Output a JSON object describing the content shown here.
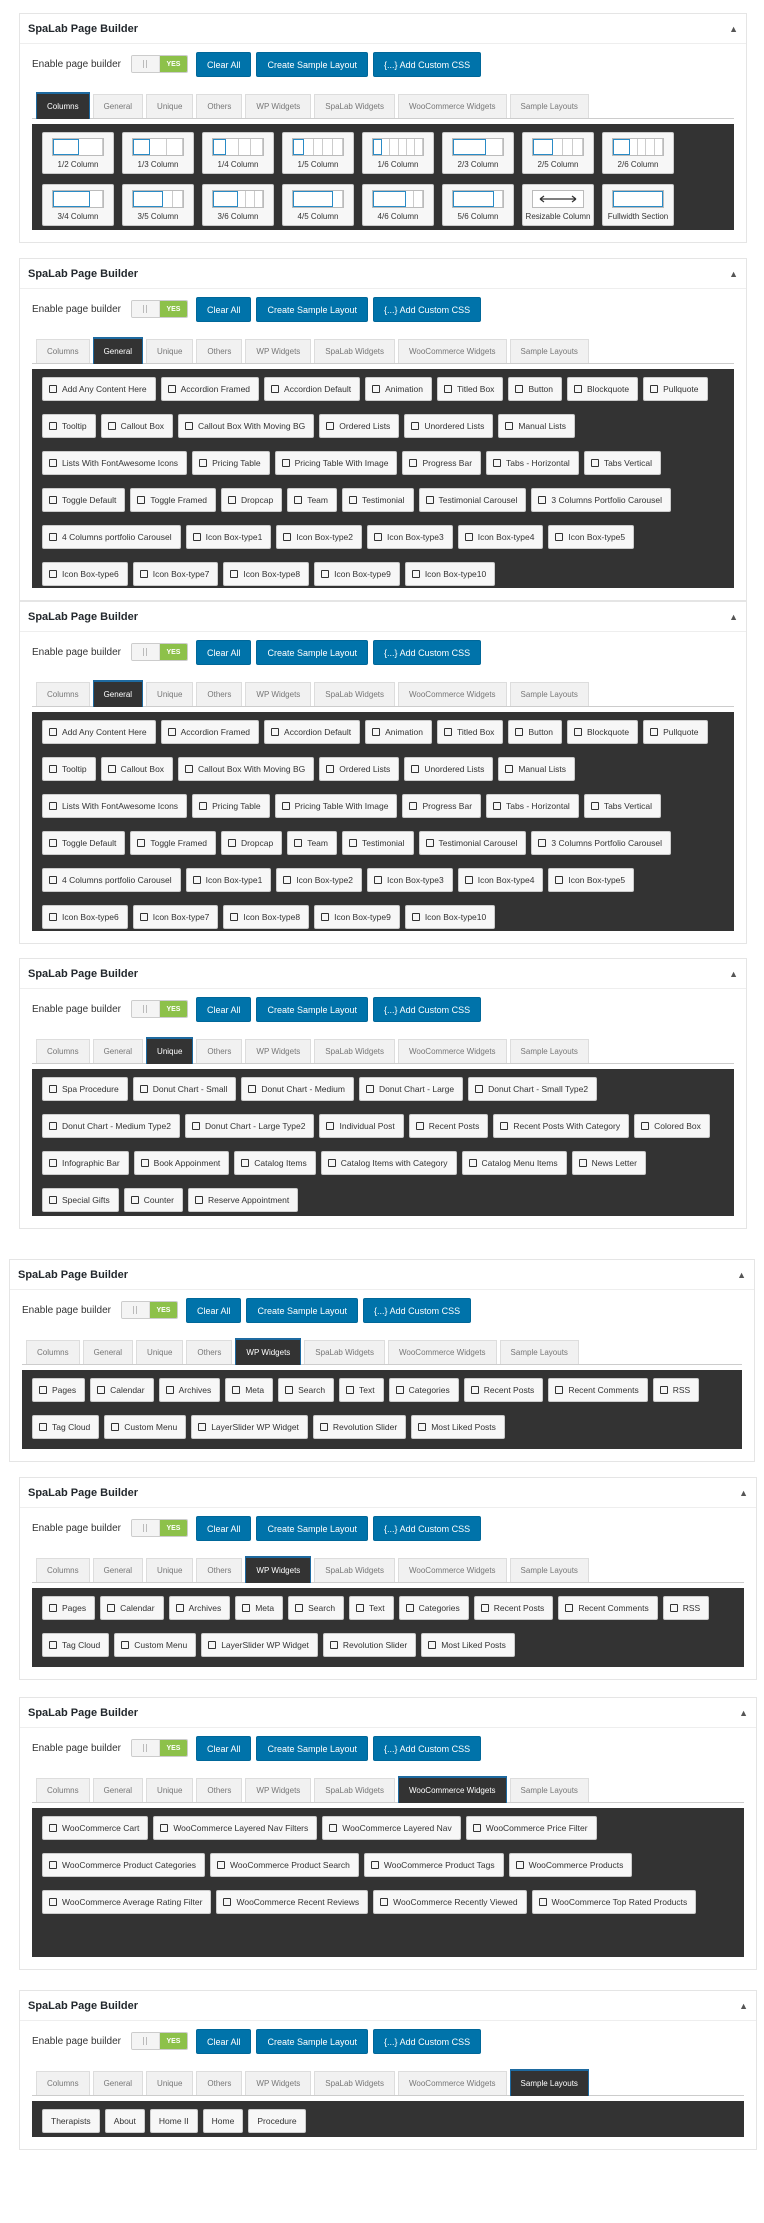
{
  "builder": {
    "title": "SpaLab Page Builder",
    "collapse_icon": "▲",
    "enable_label": "Enable page builder",
    "toggle_on": "YES",
    "buttons": {
      "clear": "Clear All",
      "sample": "Create Sample Layout",
      "css": "{...} Add Custom CSS"
    }
  },
  "tab_labels": [
    "Columns",
    "General",
    "Unique",
    "Others",
    "WP Widgets",
    "SpaLab Widgets",
    "WooCommerce Widgets",
    "Sample Layouts"
  ],
  "panels": [
    {
      "active_tab": 0,
      "columns": [
        "1/2 Column",
        "1/3 Column",
        "1/4 Column",
        "1/5 Column",
        "1/6 Column",
        "2/3 Column",
        "2/5 Column",
        "2/6 Column",
        "3/4 Column",
        "3/5 Column",
        "3/6 Column",
        "4/5 Column",
        "4/6 Column",
        "5/6 Column",
        "Resizable Column",
        "Fullwidth Section"
      ]
    },
    {
      "active_tab": 1,
      "items": [
        "Add Any Content Here",
        "Accordion Framed",
        "Accordion Default",
        "Animation",
        "Titled Box",
        "Button",
        "Blockquote",
        "Pullquote",
        "Tooltip",
        "Callout Box",
        "Callout Box With Moving BG",
        "Ordered Lists",
        "Unordered Lists",
        "Manual Lists",
        "Lists With FontAwesome Icons",
        "Pricing Table",
        "Pricing Table With Image",
        "Progress Bar",
        "Tabs - Horizontal",
        "Tabs Vertical",
        "Toggle Default",
        "Toggle Framed",
        "Dropcap",
        "Team",
        "Testimonial",
        "Testimonial Carousel",
        "3 Columns Portfolio Carousel",
        "4 Columns portfolio Carousel",
        "Icon Box-type1",
        "Icon Box-type2",
        "Icon Box-type3",
        "Icon Box-type4",
        "Icon Box-type5",
        "Icon Box-type6",
        "Icon Box-type7",
        "Icon Box-type8",
        "Icon Box-type9",
        "Icon Box-type10"
      ]
    },
    {
      "active_tab": 1,
      "items": [
        "Add Any Content Here",
        "Accordion Framed",
        "Accordion Default",
        "Animation",
        "Titled Box",
        "Button",
        "Blockquote",
        "Pullquote",
        "Tooltip",
        "Callout Box",
        "Callout Box With Moving BG",
        "Ordered Lists",
        "Unordered Lists",
        "Manual Lists",
        "Lists With FontAwesome Icons",
        "Pricing Table",
        "Pricing Table With Image",
        "Progress Bar",
        "Tabs - Horizontal",
        "Tabs Vertical",
        "Toggle Default",
        "Toggle Framed",
        "Dropcap",
        "Team",
        "Testimonial",
        "Testimonial Carousel",
        "3 Columns Portfolio Carousel",
        "4 Columns portfolio Carousel",
        "Icon Box-type1",
        "Icon Box-type2",
        "Icon Box-type3",
        "Icon Box-type4",
        "Icon Box-type5",
        "Icon Box-type6",
        "Icon Box-type7",
        "Icon Box-type8",
        "Icon Box-type9",
        "Icon Box-type10"
      ]
    },
    {
      "active_tab": 2,
      "items": [
        "Spa Procedure",
        "Donut Chart - Small",
        "Donut Chart - Medium",
        "Donut Chart - Large",
        "Donut Chart - Small Type2",
        "Donut Chart - Medium Type2",
        "Donut Chart - Large Type2",
        "Individual Post",
        "Recent Posts",
        "Recent Posts With Category",
        "Colored Box",
        "Infographic Bar",
        "Book Appoinment",
        "Catalog Items",
        "Catalog Items with Category",
        "Catalog Menu Items",
        "News Letter",
        "Special Gifts",
        "Counter",
        "Reserve Appointment"
      ]
    },
    {
      "active_tab": 4,
      "items": [
        "Pages",
        "Calendar",
        "Archives",
        "Meta",
        "Search",
        "Text",
        "Categories",
        "Recent Posts",
        "Recent Comments",
        "RSS",
        "Tag Cloud",
        "Custom Menu",
        "LayerSlider WP Widget",
        "Revolution Slider",
        "Most Liked Posts"
      ]
    },
    {
      "active_tab": 4,
      "items": [
        "Pages",
        "Calendar",
        "Archives",
        "Meta",
        "Search",
        "Text",
        "Categories",
        "Recent Posts",
        "Recent Comments",
        "RSS",
        "Tag Cloud",
        "Custom Menu",
        "LayerSlider WP Widget",
        "Revolution Slider",
        "Most Liked Posts"
      ]
    },
    {
      "active_tab": 6,
      "items": [
        "WooCommerce Cart",
        "WooCommerce Layered Nav Filters",
        "WooCommerce Layered Nav",
        "WooCommerce Price Filter",
        "WooCommerce Product Categories",
        "WooCommerce Product Search",
        "WooCommerce Product Tags",
        "WooCommerce Products",
        "WooCommerce Average Rating Filter",
        "WooCommerce Recent Reviews",
        "WooCommerce Recently Viewed",
        "WooCommerce Top Rated Products"
      ]
    },
    {
      "active_tab": 7,
      "items": [
        "Therapists",
        "About",
        "Home II",
        "Home",
        "Procedure"
      ]
    }
  ],
  "colors": {
    "dark_bg": "#333333",
    "primary_button": "#0073aa",
    "toggle_on": "#8dc14a",
    "active_tab_border": "#1e6aa0"
  }
}
